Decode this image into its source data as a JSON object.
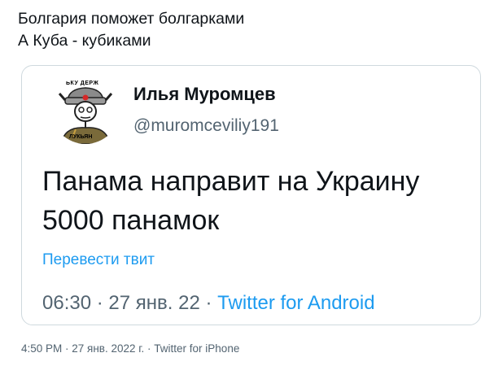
{
  "tweet": {
    "text_line1": "Болгария поможет болгарками",
    "text_line2": "А Куба - кубиками",
    "timestamp": "4:50 PM · 27 янв. 2022 г. · Twitter for iPhone"
  },
  "quoted": {
    "author_name": "Илья Муромцев",
    "author_handle": "@muromceviliy191",
    "avatar": {
      "label_top": "ЬКУ ДЕРЖ",
      "label_bottom": "ЛУКЬЯН",
      "icon": "avatar-cartoon-icon"
    },
    "body_line1": "Панама направит на Украину",
    "body_line2": "5000 панамок",
    "translate_label": "Перевести твит",
    "time": "06:30",
    "date": "27 янв. 22",
    "separator": "·",
    "source": "Twitter for Android"
  },
  "colors": {
    "text": "#0f1419",
    "secondary": "#536471",
    "link": "#1d9bf0",
    "border": "#cfd9de"
  }
}
